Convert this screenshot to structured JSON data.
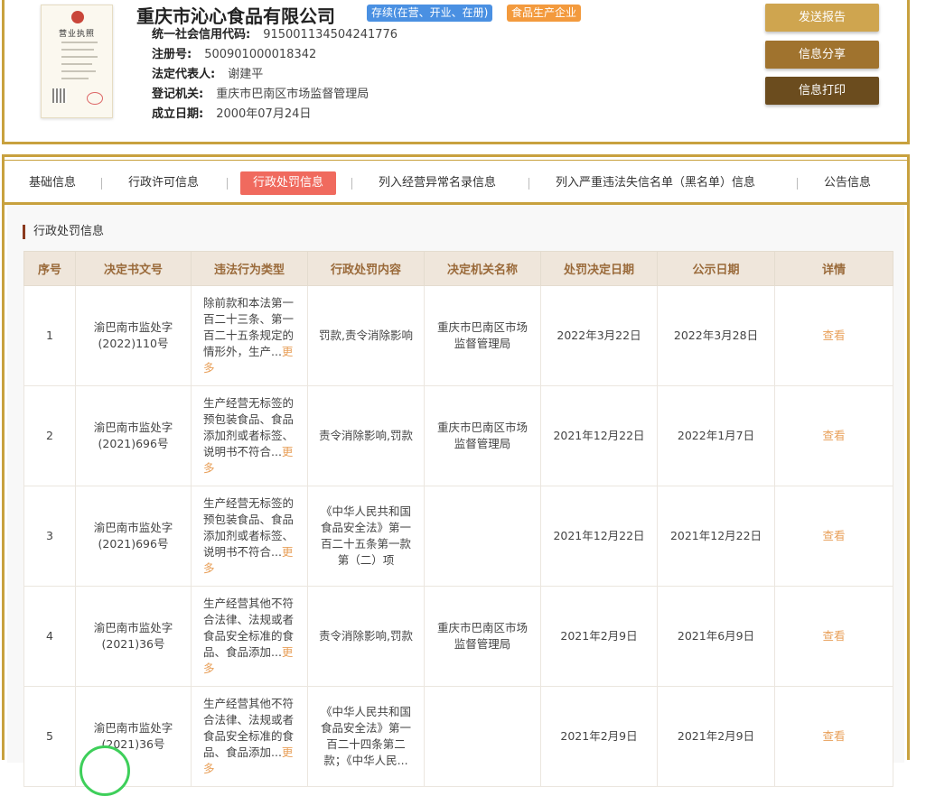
{
  "company": {
    "name": "重庆市沁心食品有限公司",
    "status_tag": "存续(在营、开业、在册)",
    "type_tag": "食品生产企业",
    "license_title": "营业执照"
  },
  "info": [
    {
      "label": "统一社会信用代码:",
      "value": "915001134504241776"
    },
    {
      "label": "注册号:",
      "value": "500901000018342"
    },
    {
      "label": "法定代表人:",
      "value": "谢建平"
    },
    {
      "label": "登记机关:",
      "value": "重庆市巴南区市场监督管理局"
    },
    {
      "label": "成立日期:",
      "value": "2000年07月24日"
    }
  ],
  "actions": {
    "send_report": "发送报告",
    "share": "信息分享",
    "print": "信息打印"
  },
  "tabs": [
    {
      "label": "基础信息"
    },
    {
      "label": "行政许可信息"
    },
    {
      "label": "行政处罚信息"
    },
    {
      "label": "列入经营异常名录信息"
    },
    {
      "label": "列入严重违法失信名单（黑名单）信息"
    },
    {
      "label": "公告信息"
    }
  ],
  "section_title": "行政处罚信息",
  "table": {
    "headers": [
      "序号",
      "决定书文号",
      "违法行为类型",
      "行政处罚内容",
      "决定机关名称",
      "处罚决定日期",
      "公示日期",
      "详情"
    ],
    "more_label": "更多",
    "view_label": "查看",
    "rows": [
      {
        "no": "1",
        "doc": "渝巴南市监处字(2022)110号",
        "violation": "除前款和本法第一百二十三条、第一百二十五条规定的情形外，生产...",
        "content": "罚款,责令消除影响",
        "authority": "重庆市巴南区市场监督管理局",
        "decision_date": "2022年3月22日",
        "publish_date": "2022年3月28日"
      },
      {
        "no": "2",
        "doc": "渝巴南市监处字(2021)696号",
        "violation": "生产经营无标签的预包装食品、食品添加剂或者标签、说明书不符合...",
        "content": "责令消除影响,罚款",
        "authority": "重庆市巴南区市场监督管理局",
        "decision_date": "2021年12月22日",
        "publish_date": "2022年1月7日"
      },
      {
        "no": "3",
        "doc": "渝巴南市监处字(2021)696号",
        "violation": "生产经营无标签的预包装食品、食品添加剂或者标签、说明书不符合...",
        "content": "《中华人民共和国食品安全法》第一百二十五条第一款第（二）项",
        "authority": "",
        "decision_date": "2021年12月22日",
        "publish_date": "2021年12月22日"
      },
      {
        "no": "4",
        "doc": "渝巴南市监处字(2021)36号",
        "violation": "生产经营其他不符合法律、法规或者食品安全标准的食品、食品添加...",
        "content": "责令消除影响,罚款",
        "authority": "重庆市巴南区市场监督管理局",
        "decision_date": "2021年2月9日",
        "publish_date": "2021年6月9日"
      },
      {
        "no": "5",
        "doc": "渝巴南市监处字(2021)36号",
        "violation": "生产经营其他不符合法律、法规或者食品安全标准的食品、食品添加...",
        "content": "《中华人民共和国食品安全法》第一百二十四条第二款；《中华人民...",
        "authority": "",
        "decision_date": "2021年2月9日",
        "publish_date": "2021年2月9日"
      }
    ]
  }
}
